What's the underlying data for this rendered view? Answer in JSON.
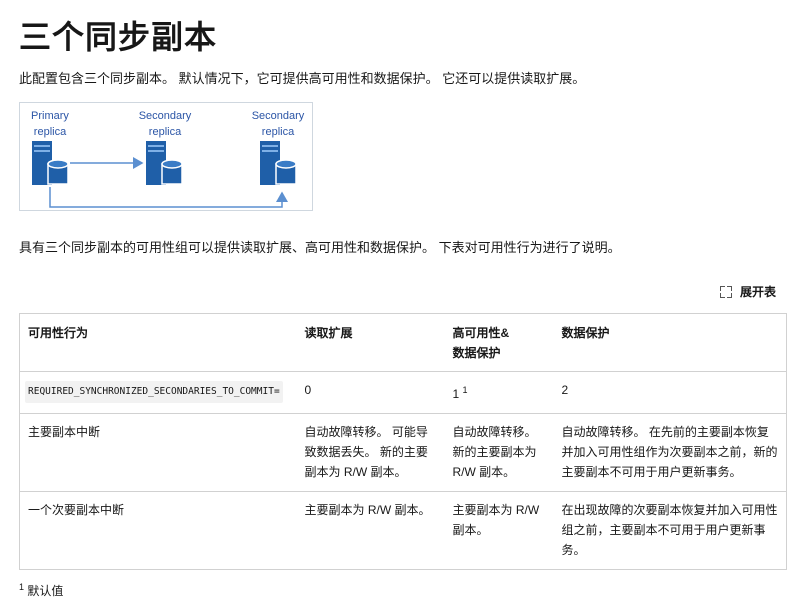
{
  "page": {
    "title": "三个同步副本",
    "intro": "此配置包含三个同步副本。 默认情况下，它可提供高可用性和数据保护。 它还可以提供读取扩展。",
    "description": "具有三个同步副本的可用性组可以提供读取扩展、高可用性和数据保护。 下表对可用性行为进行了说明。",
    "expand_label": "展开表"
  },
  "diagram": {
    "nodes": [
      {
        "line1": "Primary",
        "line2": "replica"
      },
      {
        "line1": "Secondary",
        "line2": "replica"
      },
      {
        "line1": "Secondary",
        "line2": "replica"
      }
    ],
    "server_color": "#1f5fa8",
    "arrow_color": "#5b8fd0"
  },
  "table": {
    "headers": [
      "可用性行为",
      "读取扩展",
      "高可用性&\n数据保护",
      "数据保护"
    ],
    "header_line1": "高可用性&",
    "header_line2": "数据保护",
    "rows": [
      {
        "behavior": "REQUIRED_SYNCHRONIZED_SECONDARIES_TO_COMMIT=",
        "read": "0",
        "ha": "1",
        "ha_sup": "1",
        "dp": "2"
      },
      {
        "behavior": "主要副本中断",
        "read": "自动故障转移。 可能导致数据丢失。 新的主要副本为 R/W 副本。",
        "ha": "自动故障转移。 新的主要副本为 R/W 副本。",
        "dp": "自动故障转移。 在先前的主要副本恢复并加入可用性组作为次要副本之前，新的主要副本不可用于用户更新事务。"
      },
      {
        "behavior": "一个次要副本中断",
        "read": "主要副本为 R/W 副本。",
        "ha": "主要副本为 R/W 副本。",
        "dp": "在出现故障的次要副本恢复并加入可用性组之前，主要副本不可用于用户更新事务。"
      }
    ]
  },
  "footnote": {
    "marker": "1",
    "text": "默认值"
  }
}
